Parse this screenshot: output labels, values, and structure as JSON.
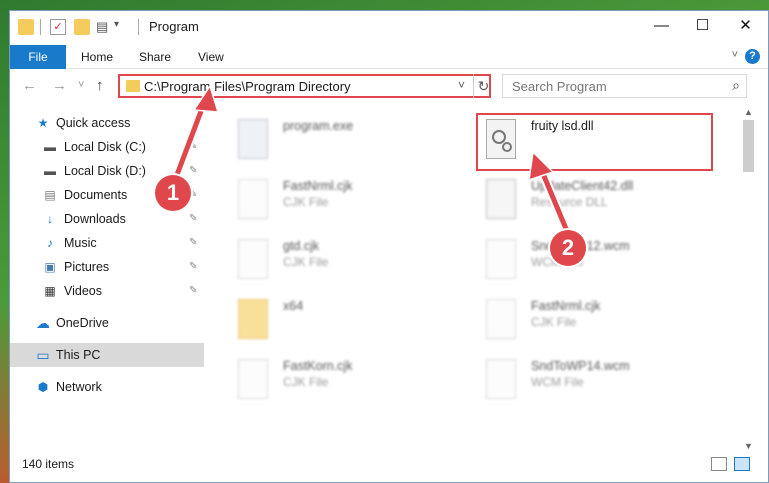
{
  "window": {
    "title": "Program"
  },
  "title_controls": {
    "minimize": "—",
    "maximize": "☐",
    "close": "✕"
  },
  "ribbon": {
    "tabs": [
      "File",
      "Home",
      "Share",
      "View"
    ]
  },
  "nav": {
    "back": "←",
    "forward": "→",
    "recent": "˅",
    "up": "↑"
  },
  "address": {
    "path": "C:\\Program Files\\Program Directory",
    "chevron": "˅",
    "refresh": "↻"
  },
  "search": {
    "placeholder": "Search Program",
    "icon": "⌕"
  },
  "sidebar": {
    "items": [
      {
        "label": "Quick access",
        "icon": "★"
      },
      {
        "label": "Local Disk (C:)",
        "icon": "▬"
      },
      {
        "label": "Local Disk (D:)",
        "icon": "▬"
      },
      {
        "label": "Documents",
        "icon": "▤"
      },
      {
        "label": "Downloads",
        "icon": "↓"
      },
      {
        "label": "Music",
        "icon": "♪"
      },
      {
        "label": "Pictures",
        "icon": "▣"
      },
      {
        "label": "Videos",
        "icon": "▦"
      },
      {
        "label": "OneDrive",
        "icon": "☁"
      },
      {
        "label": "This PC",
        "icon": "▭"
      },
      {
        "label": "Network",
        "icon": "⬢"
      }
    ],
    "pin_icon": "✎"
  },
  "files": [
    {
      "name": "program.exe",
      "type": ""
    },
    {
      "name": "fruity lsd.dll",
      "type": ""
    },
    {
      "name": "FastNrml.cjk",
      "type": "CJK File"
    },
    {
      "name": "UpdateClient42.dll",
      "type": "Resource DLL"
    },
    {
      "name": "gtd.cjk",
      "type": "CJK File"
    },
    {
      "name": "SndToWP12.wcm",
      "type": "WCM File"
    },
    {
      "name": "x64",
      "type": ""
    },
    {
      "name": "FastNrml.cjk",
      "type": "CJK File"
    },
    {
      "name": "FastKorn.cjk",
      "type": "CJK File"
    },
    {
      "name": "SndToWP14.wcm",
      "type": "WCM File"
    }
  ],
  "scroll": {
    "up": "▲",
    "down": "▼"
  },
  "status": {
    "items": "140 items"
  },
  "callouts": [
    "1",
    "2"
  ],
  "colors": {
    "accent": "#1979ca",
    "callout": "#e0474c"
  }
}
